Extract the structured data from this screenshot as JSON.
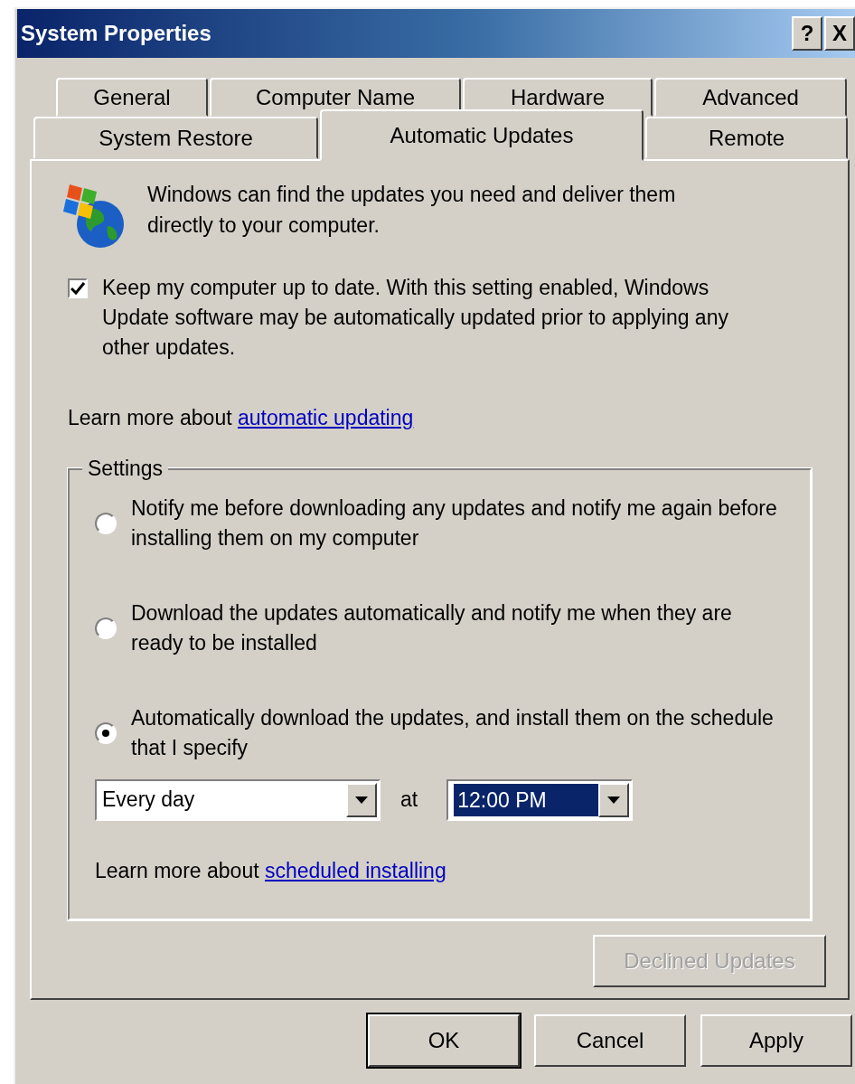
{
  "window": {
    "title": "System Properties"
  },
  "title_buttons": [
    {
      "label": "?"
    },
    {
      "label": "X"
    }
  ],
  "tab_rows": [
    [
      {
        "label": "General",
        "selected": false
      },
      {
        "label": "Computer Name",
        "selected": false
      },
      {
        "label": "Hardware",
        "selected": false
      },
      {
        "label": "Advanced",
        "selected": false
      }
    ],
    [
      {
        "label": "System Restore",
        "selected": false
      },
      {
        "label": "Automatic Updates",
        "selected": true
      },
      {
        "label": "Remote",
        "selected": false
      }
    ]
  ],
  "intro": "Windows can find the updates you need and deliver them directly to your computer.",
  "keep_updated": {
    "label": "Keep my computer up to date. With this setting enabled, Windows Update software may be automatically updated prior to applying any other updates.",
    "checked": true
  },
  "learn_more": {
    "text": "Learn more about",
    "link": "automatic updating"
  },
  "settings": {
    "title": "Settings",
    "options": [
      {
        "label": "Notify me before downloading any updates and notify me again before installing them on my computer",
        "selected": false
      },
      {
        "label": "Download the updates automatically and notify me when they are ready to be installed",
        "selected": false
      },
      {
        "label": "Automatically download the updates, and install them on the schedule that I specify",
        "selected": true
      }
    ],
    "schedule": {
      "day": "Every day",
      "at": "at",
      "time": "12:00 PM",
      "time_focused": true
    },
    "learn_more": {
      "text": "Learn more about",
      "link": "scheduled installing"
    }
  },
  "declined_button": {
    "label": "Declined Updates",
    "disabled": true
  },
  "buttons": [
    {
      "label": "OK",
      "default": true
    },
    {
      "label": "Cancel",
      "default": false
    },
    {
      "label": "Apply",
      "default": false
    }
  ]
}
